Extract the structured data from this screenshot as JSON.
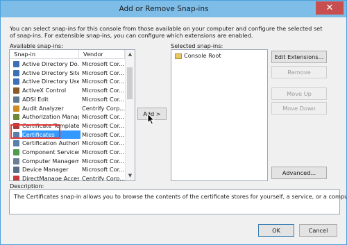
{
  "window": {
    "title": "Add or Remove Snap-ins",
    "close_glyph": "✕",
    "intro": "You can select snap-ins for this console from those available on your computer and configure the selected set of snap-ins. For extensible snap-ins, you can configure which extensions are enabled."
  },
  "available": {
    "label": "Available snap-ins:",
    "col_snapin": "Snap-in",
    "col_vendor": "Vendor",
    "items": [
      {
        "name": "Active Directory Do...",
        "vendor": "Microsoft Cor...",
        "icon": "ad-icon",
        "color": "#3c6fb4"
      },
      {
        "name": "Active Directory Site...",
        "vendor": "Microsoft Cor...",
        "icon": "ad-sites-icon",
        "color": "#3c6fb4"
      },
      {
        "name": "Active Directory Use...",
        "vendor": "Microsoft Cor...",
        "icon": "ad-users-icon",
        "color": "#3c6fb4"
      },
      {
        "name": "ActiveX Control",
        "vendor": "Microsoft Cor...",
        "icon": "activex-icon",
        "color": "#8a5a2b"
      },
      {
        "name": "ADSI Edit",
        "vendor": "Microsoft Cor...",
        "icon": "adsi-icon",
        "color": "#5f7a96"
      },
      {
        "name": "Audit Analyzer",
        "vendor": "Centrify Corp...",
        "icon": "audit-icon",
        "color": "#d08b22"
      },
      {
        "name": "Authorization Manager",
        "vendor": "Microsoft Cor...",
        "icon": "authz-icon",
        "color": "#6d8a3a"
      },
      {
        "name": "Certificate Templates",
        "vendor": "Microsoft Cor...",
        "icon": "cert-templates-icon",
        "color": "#b03b3b"
      },
      {
        "name": "Certificates",
        "vendor": "Microsoft Cor...",
        "icon": "certificates-icon",
        "color": "#5a7fa8",
        "selected": true
      },
      {
        "name": "Certification Authority",
        "vendor": "Microsoft Cor...",
        "icon": "ca-icon",
        "color": "#5a7fa8"
      },
      {
        "name": "Component Services",
        "vendor": "Microsoft Cor...",
        "icon": "component-icon",
        "color": "#4e9a4e"
      },
      {
        "name": "Computer Managem...",
        "vendor": "Microsoft Cor...",
        "icon": "computer-icon",
        "color": "#6a7f93"
      },
      {
        "name": "Device Manager",
        "vendor": "Microsoft Cor...",
        "icon": "device-icon",
        "color": "#57708a"
      },
      {
        "name": "DirectManage Acces...",
        "vendor": "Centrify Corp...",
        "icon": "directmanage-icon",
        "color": "#c43b3b"
      }
    ],
    "scroll_up": "▲",
    "scroll_down": "▼"
  },
  "add_button": "Add >",
  "selected": {
    "label": "Selected snap-ins:",
    "items": [
      {
        "name": "Console Root",
        "icon": "folder-icon"
      }
    ]
  },
  "buttons": {
    "edit_extensions": "Edit Extensions...",
    "remove": "Remove",
    "move_up": "Move Up",
    "move_down": "Move Down",
    "advanced": "Advanced...",
    "ok": "OK",
    "cancel": "Cancel"
  },
  "description": {
    "label": "Description:",
    "text": "The Certificates snap-in allows you to browse the contents of the certificate stores for yourself, a service, or a computer."
  },
  "colors": {
    "title_bar": "#7fbde9",
    "selection": "#3399ff",
    "highlight_box": "#e23b3b"
  }
}
